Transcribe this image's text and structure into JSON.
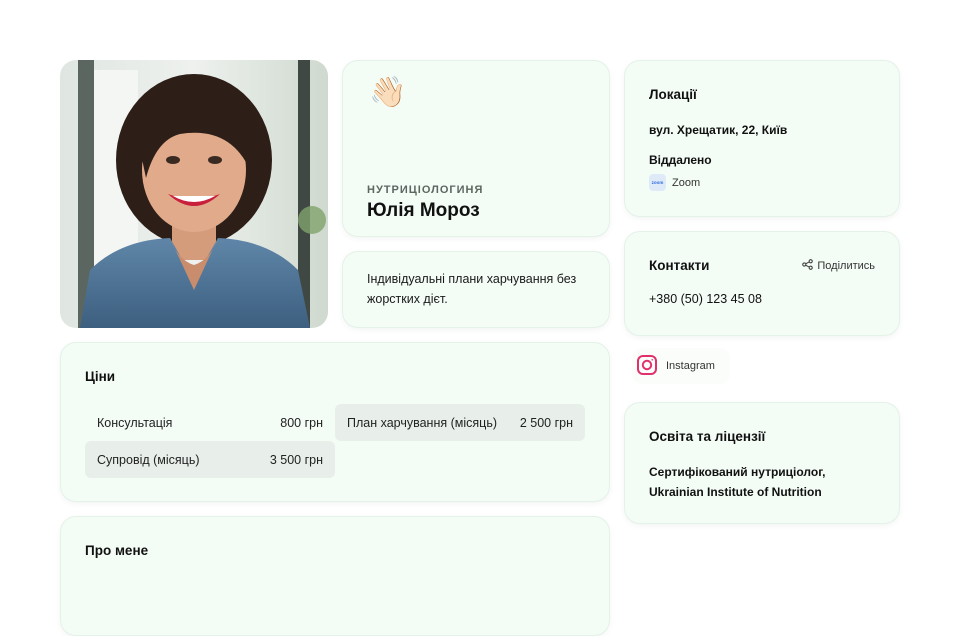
{
  "profile": {
    "wave_emoji": "👋🏻",
    "role": "НУТРИЦІОЛОГИНЯ",
    "name": "Юлія Мороз",
    "tagline": "Індивідуальні плани харчування без жорстких дієт.",
    "photo_alt": "Портрет"
  },
  "prices": {
    "title": "Ціни",
    "items": [
      {
        "label": "Консультація",
        "price": "800 грн"
      },
      {
        "label": "План харчування (місяць)",
        "price": "2 500 грн"
      },
      {
        "label": "Супровід (місяць)",
        "price": "3 500 грн"
      }
    ]
  },
  "about": {
    "title": "Про мене"
  },
  "locations": {
    "title": "Локації",
    "address": "вул. Хрещатик, 22, Київ",
    "remote_label": "Віддалено",
    "zoom_badge": "zoom",
    "zoom_label": "Zoom"
  },
  "contacts": {
    "title": "Контакти",
    "share_label": "Поділитись",
    "phone": "+380 (50) 123 45 08"
  },
  "instagram": {
    "label": "Instagram"
  },
  "education": {
    "title": "Освіта та ліцензії",
    "text": "Сертифікований нутриціолог, Ukrainian Institute of Nutrition"
  },
  "colors": {
    "card_bg": "#f4fcf6",
    "card_border": "#e4f2e8",
    "price_shade": "#e8efea",
    "instagram_accent": "#e1306c"
  }
}
